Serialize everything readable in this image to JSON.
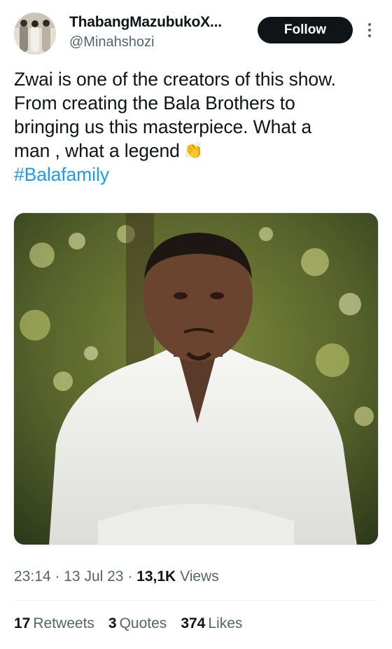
{
  "author": {
    "display_name": "ThabangMazubukoX...",
    "handle": "@Minahshozi",
    "avatar_icon": "profile-photo"
  },
  "actions": {
    "follow_label": "Follow",
    "more_icon": "more-vertical-icon"
  },
  "tweet": {
    "lines": [
      "Zwai is one of the creators of this show.",
      "From creating the Bala Brothers to",
      "bringing us this masterpiece. What a",
      "man , what a legend"
    ],
    "emoji": "👏",
    "hashtag": "#Balafamily",
    "hashtag_color": "#1d9bf0"
  },
  "media": {
    "type": "photo",
    "icon": "photo-man-white-shirt"
  },
  "meta": {
    "time": "23:14",
    "separator": "·",
    "date": "13 Jul 23",
    "views_count": "13,1K",
    "views_label": "Views"
  },
  "stats": {
    "retweets_count": "17",
    "retweets_label": "Retweets",
    "quotes_count": "3",
    "quotes_label": "Quotes",
    "likes_count": "374",
    "likes_label": "Likes"
  },
  "colors": {
    "text": "#0f1419",
    "secondary": "#536471",
    "accent": "#1d9bf0",
    "button": "#0f1419"
  }
}
